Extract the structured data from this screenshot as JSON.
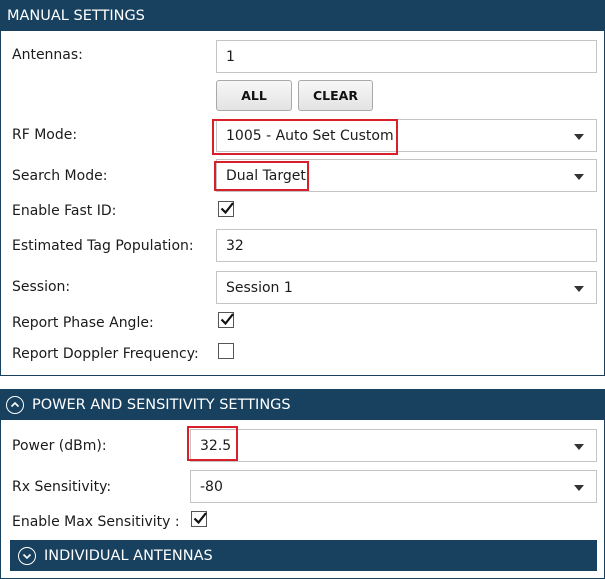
{
  "manual": {
    "title": "MANUAL SETTINGS",
    "antennas_label": "Antennas:",
    "antennas_value": "1",
    "all_button": "ALL",
    "clear_button": "CLEAR",
    "rf_mode_label": "RF Mode:",
    "rf_mode_value": "1005 - Auto Set Custom",
    "search_mode_label": "Search Mode:",
    "search_mode_value": "Dual Target",
    "fast_id_label": "Enable Fast ID:",
    "fast_id_checked": true,
    "tag_pop_label": "Estimated Tag Population:",
    "tag_pop_value": "32",
    "session_label": "Session:",
    "session_value": "Session 1",
    "phase_label": "Report Phase Angle:",
    "phase_checked": true,
    "doppler_label": "Report Doppler Frequency:",
    "doppler_checked": false
  },
  "power": {
    "title": "POWER AND SENSITIVITY SETTINGS",
    "collapse_icon": "chevron-up-circle-icon",
    "power_label": "Power (dBm):",
    "power_value": "32.5",
    "rx_label": "Rx Sensitivity:",
    "rx_value": "-80",
    "max_sens_label": "Enable Max Sensitivity :",
    "max_sens_checked": true
  },
  "antennas_section": {
    "title": "INDIVIDUAL ANTENNAS",
    "expand_icon": "chevron-down-circle-icon"
  },
  "colors": {
    "header": "#17415f",
    "highlight": "#d8202b"
  }
}
